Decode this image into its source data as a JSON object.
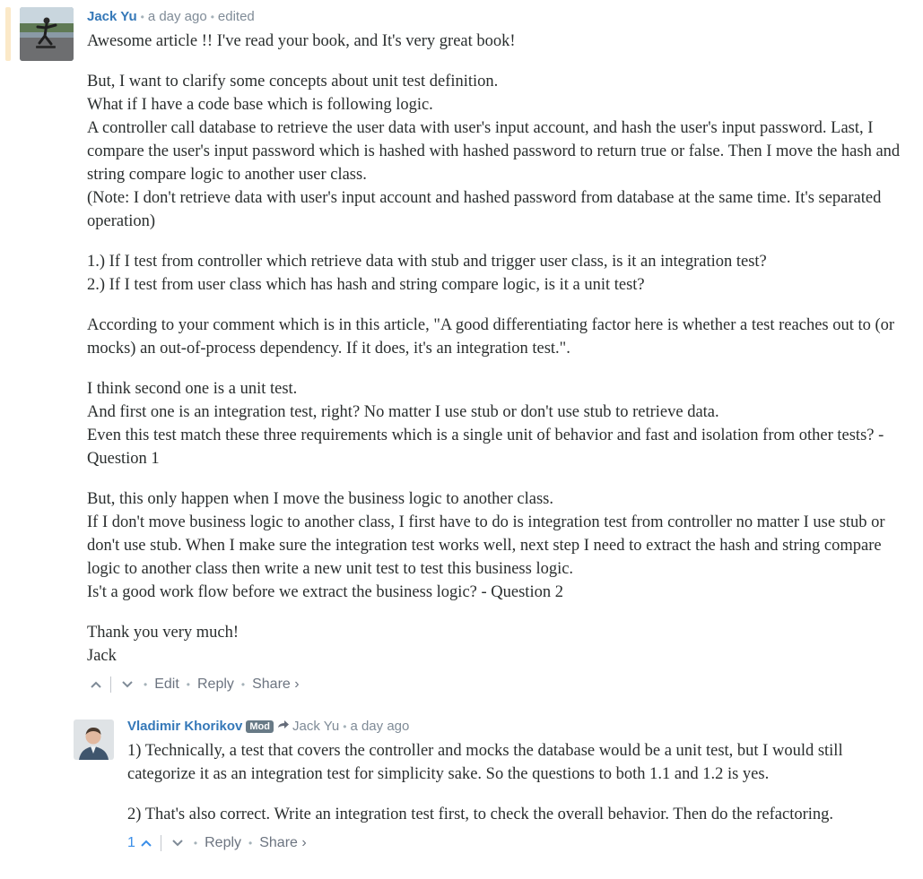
{
  "comment": {
    "author": "Jack Yu",
    "time": "a day ago",
    "edited": "edited",
    "paragraphs": [
      "Awesome article !! I've read your book, and It's very great book!",
      "But, I want to clarify some concepts about unit test definition.\nWhat if I have a code base which is following logic.\nA controller call database to retrieve the user data with user's input account, and hash the user's input password. Last, I compare the user's input password which is hashed with hashed password to return true or false. Then I move the hash and string compare logic to another user class.\n(Note: I don't retrieve data with user's input account and hashed password from database at the same time. It's separated operation)",
      "1.) If I test from controller which retrieve data with stub and trigger user class, is it an integration test?\n2.) If I test from user class which has hash and string compare logic, is it a unit test?",
      "According to your comment which is in this article, \"A good differentiating factor here is whether a test reaches out to (or mocks) an out-of-process dependency. If it does, it's an integration test.\".",
      "I think second one is a unit test.\nAnd first one is an integration test, right? No matter I use stub or don't use stub to retrieve data.\nEven this test match these three requirements which is a single unit of behavior and fast and isolation from other tests? - Question 1",
      "But, this only happen when I move the business logic to another class.\nIf I don't move business logic to another class, I first have to do is integration test from controller no matter I use stub or don't use stub. When I make sure the integration test works well, next step I need to extract the hash and string compare logic to another class then write a new unit test to test this business logic.\nIs't a good work flow before we extract the business logic? - Question 2",
      "Thank you very much!\nJack"
    ],
    "actions": {
      "edit": "Edit",
      "reply": "Reply",
      "share": "Share ›"
    }
  },
  "reply": {
    "author": "Vladimir Khorikov",
    "badge": "Mod",
    "reply_to": "Jack Yu",
    "time": "a day ago",
    "paragraphs": [
      "1) Technically, a test that covers the controller and mocks the database would be a unit test, but I would still categorize it as an integration test for simplicity sake. So the questions to both 1.1 and 1.2 is yes.",
      "2) That's also correct. Write an integration test first, to check the overall behavior. Then do the refactoring."
    ],
    "upvotes": "1",
    "actions": {
      "reply": "Reply",
      "share": "Share ›"
    }
  },
  "icons": {
    "upvote": "chevron-up-icon",
    "downvote": "chevron-down-icon",
    "reply_arrow": "reply-arrow-icon"
  },
  "colors": {
    "author": "#3578b8",
    "highlight": "#fbe9c8",
    "badge": "#687a86",
    "upvote_count": "#3a8ee8"
  }
}
